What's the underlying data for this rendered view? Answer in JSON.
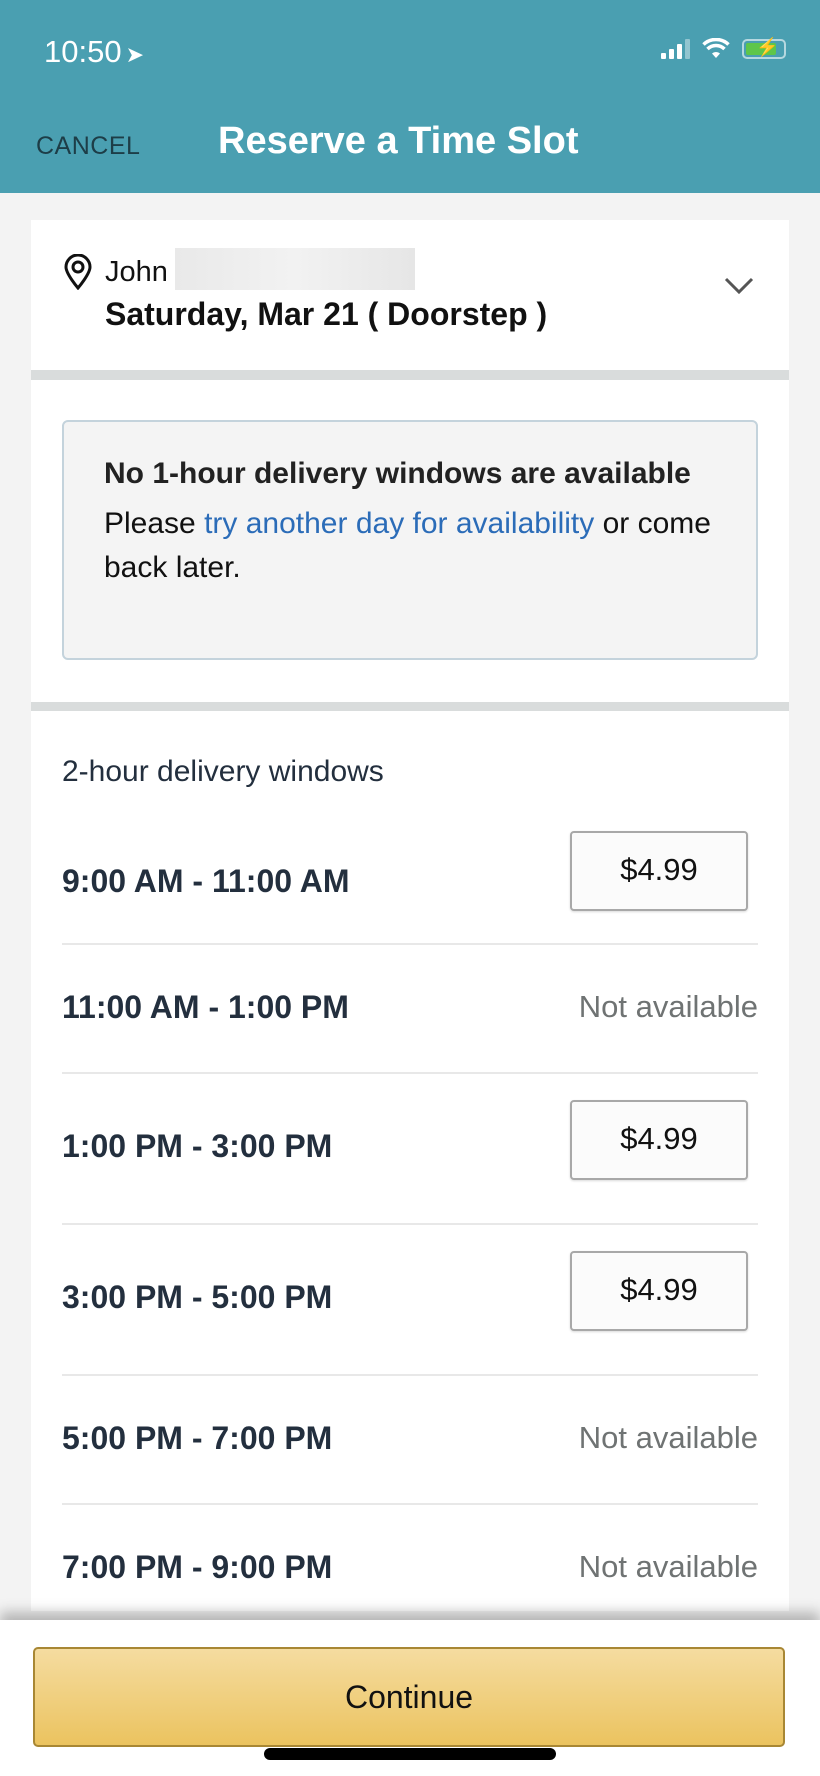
{
  "status_bar": {
    "time": "10:50",
    "location_icon": "location-arrow-icon",
    "signal_icon": "cellular-signal-icon",
    "wifi_icon": "wifi-icon",
    "battery_icon": "battery-charging-icon"
  },
  "header": {
    "cancel_label": "CANCEL",
    "title": "Reserve a Time Slot",
    "color": "#4a9fb1"
  },
  "address": {
    "icon": "location-pin-icon",
    "name": "John",
    "date_label": "Saturday, Mar 21 ( Doorstep )",
    "expand_icon": "chevron-down-icon"
  },
  "notice": {
    "heading": "No 1-hour delivery windows are available",
    "text_before": "Please ",
    "link_text": "try another day for availability",
    "text_after": " or come back later."
  },
  "two_hour": {
    "section_label": "2-hour delivery windows",
    "slots": [
      {
        "time": "9:00 AM - 11:00 AM",
        "status": "available",
        "price": "$4.99"
      },
      {
        "time": "11:00 AM - 1:00 PM",
        "status": "unavailable",
        "label": "Not available"
      },
      {
        "time": "1:00 PM - 3:00 PM",
        "status": "available",
        "price": "$4.99"
      },
      {
        "time": "3:00 PM - 5:00 PM",
        "status": "available",
        "price": "$4.99"
      },
      {
        "time": "5:00 PM - 7:00 PM",
        "status": "unavailable",
        "label": "Not available"
      },
      {
        "time": "7:00 PM - 9:00 PM",
        "status": "unavailable",
        "label": "Not available"
      }
    ]
  },
  "footer": {
    "continue_label": "Continue",
    "button_color": "#ebc35f"
  }
}
